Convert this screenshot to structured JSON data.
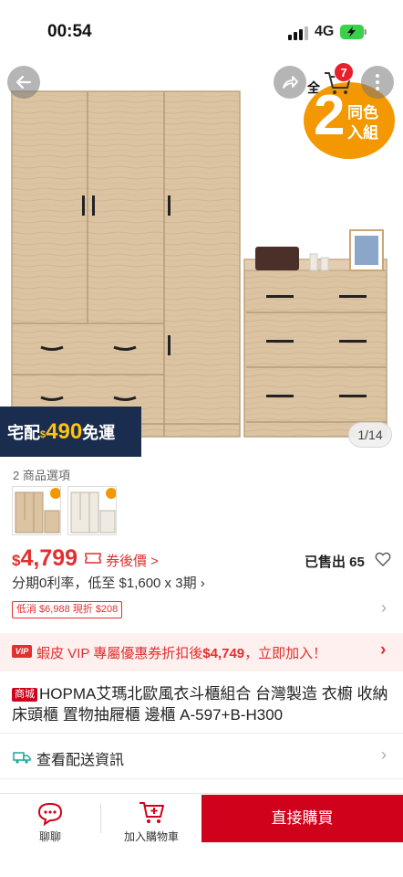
{
  "status_bar": {
    "time": "00:54",
    "network": "4G"
  },
  "gallery": {
    "cart_badge": "7",
    "partial_label": "全",
    "promo": {
      "number": "2",
      "line1": "同色",
      "line2": "入組"
    },
    "shipping": {
      "prefix": "宅配",
      "currency": "$",
      "amount": "490",
      "suffix": "免運"
    },
    "image_counter": "1/14"
  },
  "variants": {
    "label": "2 商品選項"
  },
  "price": {
    "currency": "$",
    "value": "4,799",
    "coupon_link": "券後價 >",
    "sold": "已售出 65",
    "installment": "分期0利率，低至 $1,600 x 3期 ›",
    "discount_tag": "低消 $6,988 現折 $208"
  },
  "vip": {
    "icon": "VIP",
    "text_prefix": "蝦皮 VIP 專屬優惠券折扣後",
    "amount": "$4,749",
    "text_suffix": "，立即加入！"
  },
  "product": {
    "mall_tag": "商城",
    "title": "HOPMA艾瑪北歐風衣斗櫃組合 台灣製造 衣櫥 收納床頭櫃 置物抽屜櫃 邊櫃 A-597+B-H300"
  },
  "delivery": {
    "label": "查看配送資訊"
  },
  "bottom_bar": {
    "chat_label": "聊聊",
    "cart_label": "加入購物車",
    "buy_label": "直接購買"
  },
  "colors": {
    "brand": "#d0011b",
    "price": "#e32f2f",
    "promo": "#f39800",
    "banner": "#1a2d4e"
  }
}
